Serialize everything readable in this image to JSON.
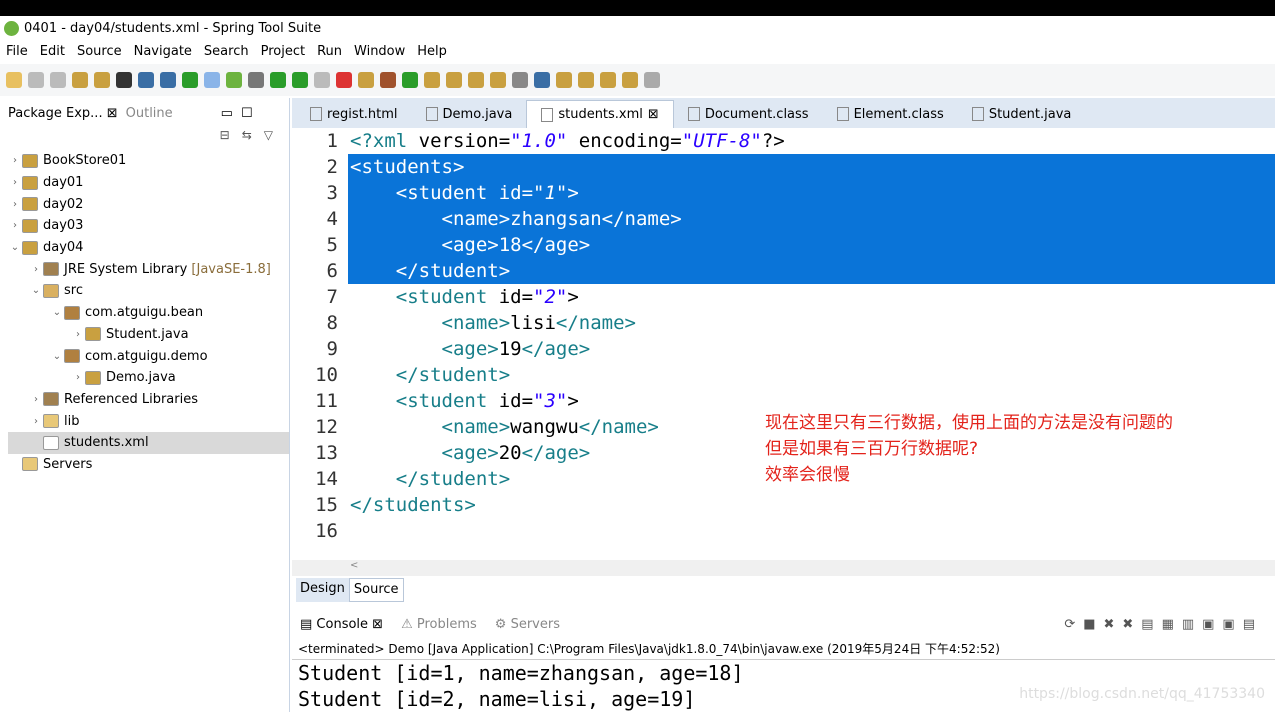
{
  "window": {
    "title": "0401 - day04/students.xml - Spring Tool Suite"
  },
  "menu": [
    "File",
    "Edit",
    "Source",
    "Navigate",
    "Search",
    "Project",
    "Run",
    "Window",
    "Help"
  ],
  "left_panel": {
    "tabs": [
      "Package Exp...",
      "Outline"
    ],
    "tree": [
      {
        "label": "BookStore01",
        "depth": 0,
        "chevron": "right",
        "icon": "project"
      },
      {
        "label": "day01",
        "depth": 0,
        "chevron": "right",
        "icon": "project"
      },
      {
        "label": "day02",
        "depth": 0,
        "chevron": "right",
        "icon": "project"
      },
      {
        "label": "day03",
        "depth": 0,
        "chevron": "right",
        "icon": "project"
      },
      {
        "label": "day04",
        "depth": 0,
        "chevron": "down",
        "icon": "project"
      },
      {
        "label": "JRE System Library",
        "deco": "[JavaSE-1.8]",
        "depth": 1,
        "chevron": "right",
        "icon": "library"
      },
      {
        "label": "src",
        "depth": 1,
        "chevron": "down",
        "icon": "source-folder"
      },
      {
        "label": "com.atguigu.bean",
        "depth": 2,
        "chevron": "down",
        "icon": "package"
      },
      {
        "label": "Student.java",
        "depth": 3,
        "chevron": "right",
        "icon": "java-file"
      },
      {
        "label": "com.atguigu.demo",
        "depth": 2,
        "chevron": "down",
        "icon": "package"
      },
      {
        "label": "Demo.java",
        "depth": 3,
        "chevron": "right",
        "icon": "java-file"
      },
      {
        "label": "Referenced Libraries",
        "depth": 1,
        "chevron": "right",
        "icon": "library"
      },
      {
        "label": "lib",
        "depth": 1,
        "chevron": "right",
        "icon": "folder"
      },
      {
        "label": "students.xml",
        "depth": 1,
        "chevron": "",
        "icon": "xml-file",
        "selected": true
      },
      {
        "label": "Servers",
        "depth": 0,
        "chevron": "",
        "icon": "folder"
      }
    ]
  },
  "editor": {
    "tabs": [
      {
        "label": "regist.html"
      },
      {
        "label": "Demo.java"
      },
      {
        "label": "students.xml",
        "active": true
      },
      {
        "label": "Document.class"
      },
      {
        "label": "Element.class"
      },
      {
        "label": "Student.java"
      }
    ],
    "lines": [
      {
        "n": "1",
        "text": "<?xml version=\"1.0\" encoding=\"UTF-8\"?>"
      },
      {
        "n": "2",
        "text": "<students>",
        "selected": true
      },
      {
        "n": "3",
        "text": "    <student id=\"1\">",
        "selected": true
      },
      {
        "n": "4",
        "text": "        <name>zhangsan</name>",
        "selected": true
      },
      {
        "n": "5",
        "text": "        <age>18</age>",
        "selected": true
      },
      {
        "n": "6",
        "text": "    </student>",
        "selected": true
      },
      {
        "n": "7",
        "text": "    <student id=\"2\">"
      },
      {
        "n": "8",
        "text": "        <name>lisi</name>"
      },
      {
        "n": "9",
        "text": "        <age>19</age>"
      },
      {
        "n": "10",
        "text": "    </student>"
      },
      {
        "n": "11",
        "text": "    <student id=\"3\">"
      },
      {
        "n": "12",
        "text": "        <name>wangwu</name>"
      },
      {
        "n": "13",
        "text": "        <age>20</age>"
      },
      {
        "n": "14",
        "text": "    </student>"
      },
      {
        "n": "15",
        "text": "</students>"
      },
      {
        "n": "16",
        "text": ""
      }
    ],
    "note": [
      "现在这里只有三行数据，使用上面的方法是没有问题的",
      "但是如果有三百万行数据呢?",
      "效率会很慢"
    ],
    "bottom_tabs": [
      "Design",
      "Source"
    ]
  },
  "console": {
    "tabs": [
      "Console",
      "Problems",
      "Servers"
    ],
    "status": "<terminated> Demo [Java Application] C:\\Program Files\\Java\\jdk1.8.0_74\\bin\\javaw.exe (2019年5月24日 下午4:52:52)",
    "output": [
      "Student [id=1, name=zhangsan, age=18]",
      "Student [id=2, name=lisi, age=19]"
    ]
  },
  "watermark": "https://blog.csdn.net/qq_41753340",
  "colors": {
    "selection": "#0a74d8",
    "note": "#e3231b",
    "tag": "#177e89",
    "attr": "#7f007f",
    "value": "#2a00ff"
  }
}
